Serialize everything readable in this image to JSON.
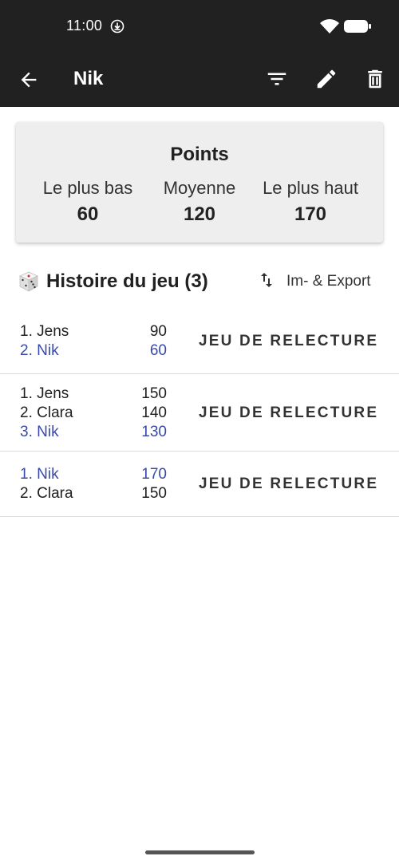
{
  "status_bar": {
    "time": "11:00"
  },
  "app_bar": {
    "title": "Nik",
    "actions": [
      "back-icon",
      "filter-icon",
      "edit-icon",
      "delete-icon"
    ]
  },
  "stats": {
    "title": "Points",
    "lowest": {
      "label": "Le plus bas",
      "value": "60"
    },
    "average": {
      "label": "Moyenne",
      "value": "120"
    },
    "highest": {
      "label": "Le plus haut",
      "value": "170"
    }
  },
  "history": {
    "title": "Histoire du jeu (3)",
    "import_export_label": "Im- & Export",
    "games": [
      {
        "rows": [
          {
            "name": "1. Jens",
            "score": "90",
            "highlight": false
          },
          {
            "name": "2. Nik",
            "score": "60",
            "highlight": true
          }
        ],
        "replay_label": "JEU DE RELECTURE"
      },
      {
        "rows": [
          {
            "name": "1. Jens",
            "score": "150",
            "highlight": false
          },
          {
            "name": "2. Clara",
            "score": "140",
            "highlight": false
          },
          {
            "name": "3. Nik",
            "score": "130",
            "highlight": true
          }
        ],
        "replay_label": "JEU DE RELECTURE"
      },
      {
        "rows": [
          {
            "name": "1. Nik",
            "score": "170",
            "highlight": true
          },
          {
            "name": "2. Clara",
            "score": "150",
            "highlight": false
          }
        ],
        "replay_label": "JEU DE RELECTURE"
      }
    ]
  },
  "colors": {
    "app_bar_bg": "#212121",
    "highlight_player": "#3949ab",
    "card_bg": "#eeeeee"
  }
}
